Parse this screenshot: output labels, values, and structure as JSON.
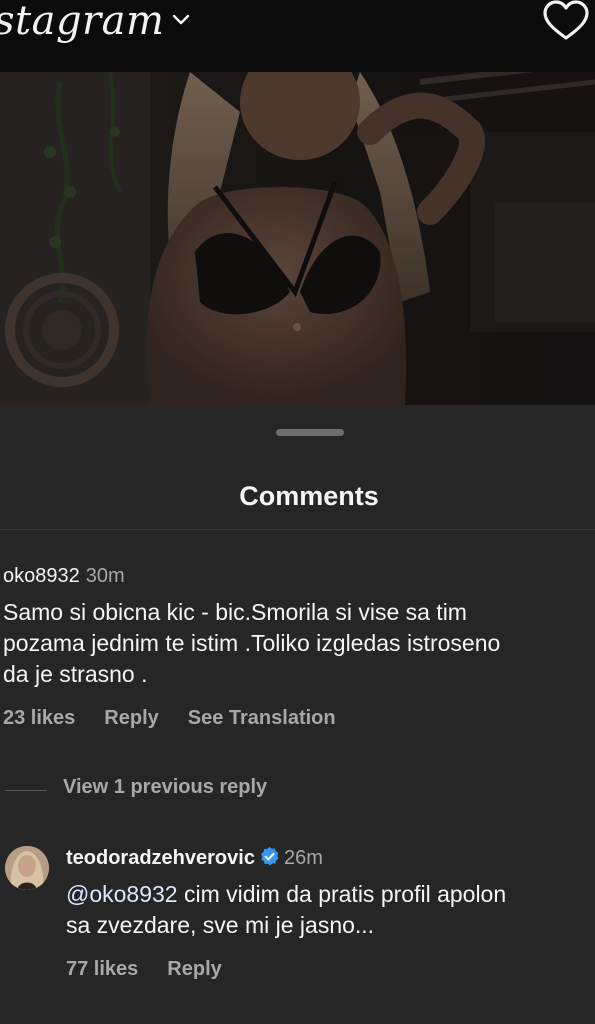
{
  "app": {
    "logo_text": "stagram"
  },
  "icons": {
    "chevron": "chevron-down-icon",
    "heart": "heart-icon",
    "verified": "verified-badge-icon"
  },
  "colors": {
    "background": "#262626",
    "topbar": "#0b0b0b",
    "primary_text": "#f5f5f5",
    "secondary_text": "#a8a8a8",
    "verified": "#3897f0"
  },
  "sheet": {
    "title": "Comments"
  },
  "comment": {
    "username": "oko8932",
    "time": "30m",
    "text_lines": [
      "Samo si obicna kic - bic.Smorila si vise sa tim",
      "pozama jednim te istim .Toliko izgledas istroseno",
      "da je strasno ."
    ],
    "likes": "23 likes",
    "reply": "Reply",
    "see_translation": "See Translation"
  },
  "view_previous": "View 1 previous reply",
  "reply": {
    "username": "teodoradzehverovic",
    "time": "26m",
    "mention": "@oko8932",
    "text_line1_rest": " cim vidim da pratis profil apolon",
    "text_line2": "sa zvezdare, sve mi je jasno...",
    "likes": "77 likes",
    "reply": "Reply"
  }
}
